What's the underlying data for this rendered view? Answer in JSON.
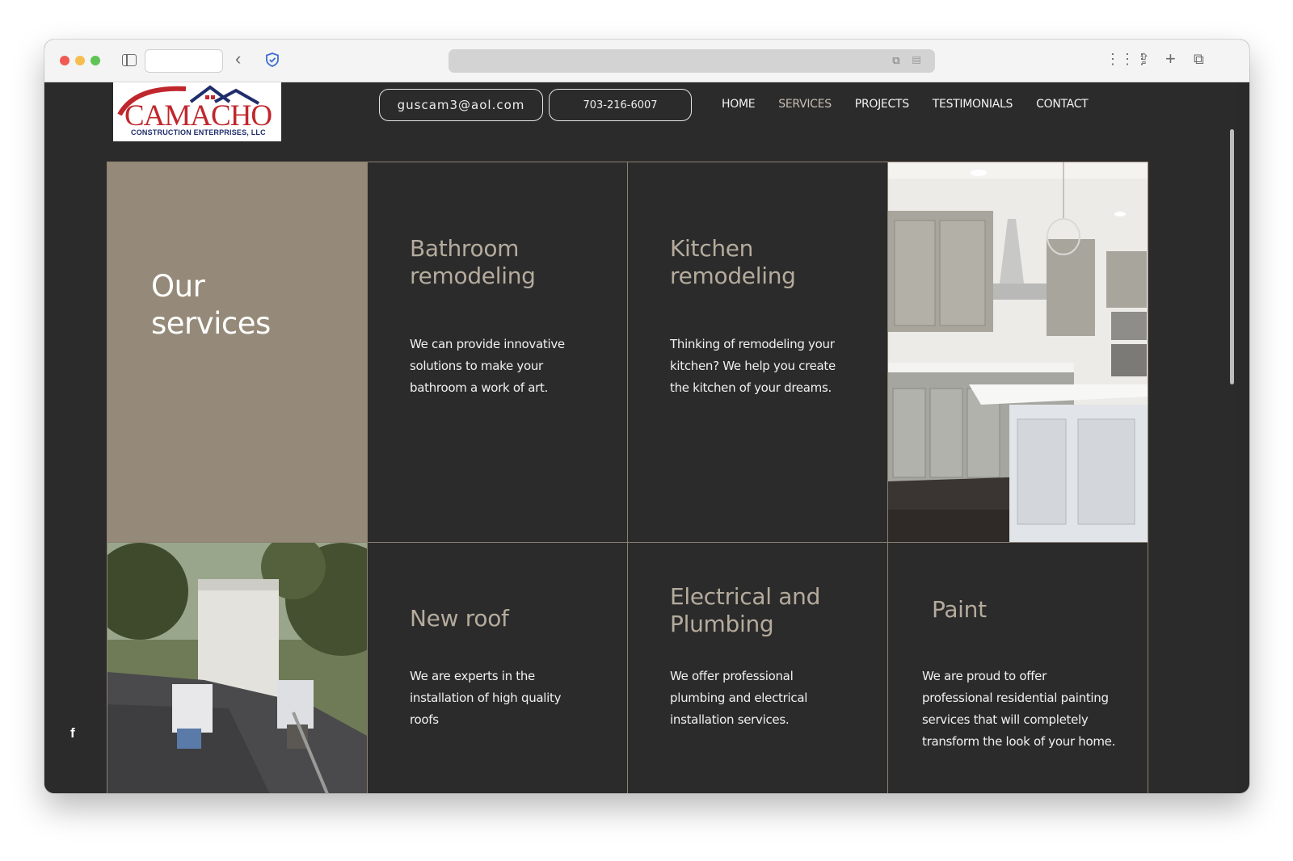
{
  "browser": {
    "back_glyph": "‹",
    "url_icons": "⧉ ▤",
    "grid_glyph": "⋮⋮⋮",
    "share_glyph": "⇪",
    "plus_glyph": "+",
    "tabs_glyph": "⧉"
  },
  "header": {
    "logo_main": "CAMACHO",
    "logo_sub": "CONSTRUCTION ENTERPRISES, LLC",
    "email": "guscam3@aol.com",
    "phone": "703-216-6007",
    "nav": [
      "HOME",
      "SERVICES",
      "PROJECTS",
      "TESTIMONIALS",
      "CONTACT"
    ],
    "active_nav": "SERVICES"
  },
  "hero": {
    "title": "Our services"
  },
  "services": [
    {
      "title": "Bathroom remodeling",
      "description": "We can provide innovative solutions to make your bathroom a work of art."
    },
    {
      "title": "Kitchen remodeling",
      "description": "Thinking of remodeling your kitchen? We help you create the kitchen of your dreams."
    },
    {
      "title": "New roof",
      "description": "We are experts in the installation of high quality roofs"
    },
    {
      "title": "Electrical and Plumbing",
      "description": "We offer professional plumbing and electrical installation services."
    },
    {
      "title": "Paint",
      "description": "We are proud to offer professional residential painting services that will completely transform the look of your home."
    }
  ],
  "social": {
    "facebook_glyph": "f"
  },
  "colors": {
    "background": "#2b2b2b",
    "hero": "#958a79",
    "title": "#b5ab9d",
    "border": "#8c8072"
  },
  "icons": [
    "sidebar-icon",
    "back-icon",
    "shield-icon",
    "translate-icon",
    "reader-icon",
    "grid-icon",
    "share-icon",
    "plus-icon",
    "tabs-icon",
    "facebook-icon"
  ]
}
